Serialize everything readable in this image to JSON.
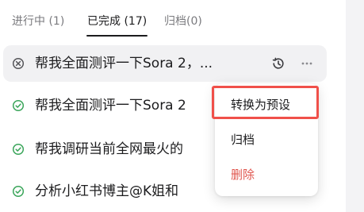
{
  "tabs": [
    {
      "label": "进行中 (1)",
      "active": false
    },
    {
      "label": "已完成 (17)",
      "active": true
    },
    {
      "label": "归档(0)",
      "active": false
    }
  ],
  "tasks": [
    {
      "title": "帮我全面测评一下Sora 2，...",
      "status": "cancelled",
      "icon": "x-circle-icon"
    },
    {
      "title": "帮我全面测评一下Sora 2",
      "status": "completed",
      "icon": "check-circle-icon"
    },
    {
      "title": "帮我调研当前全网最火的",
      "status": "completed",
      "icon": "check-circle-icon"
    },
    {
      "title": "分析小红书博主@K姐和",
      "status": "completed",
      "icon": "check-circle-icon"
    }
  ],
  "row_actions": {
    "history_icon": "history-icon",
    "more_icon": "more-horizontal-icon"
  },
  "context_menu": {
    "items": [
      {
        "label": "转换为预设",
        "highlighted": true
      },
      {
        "label": "归档",
        "highlighted": false
      },
      {
        "label": "删除",
        "danger": true
      }
    ]
  },
  "colors": {
    "accent_green": "#3aa55a",
    "danger_red": "#e0564e",
    "highlight_border": "#f0504a",
    "selected_row_bg": "#f1f1f3"
  }
}
